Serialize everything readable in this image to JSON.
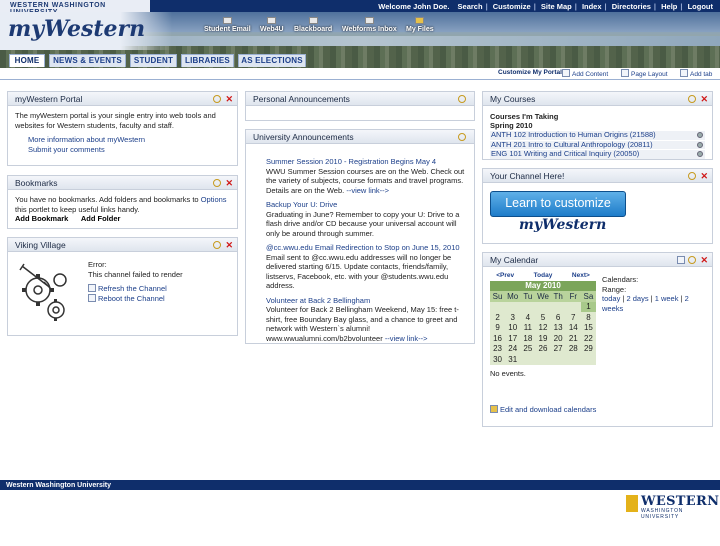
{
  "header": {
    "university": "WESTERN WASHINGTON UNIVERSITY",
    "welcome": "Welcome John Doe.",
    "links": [
      "Search",
      "Customize",
      "Site Map",
      "Index",
      "Directories",
      "Help",
      "Logout"
    ],
    "logo": "myWestern",
    "quick_links": [
      {
        "label": "Student Email",
        "icon": "email-icon"
      },
      {
        "label": "Web4U",
        "icon": "web4u-icon"
      },
      {
        "label": "Blackboard",
        "icon": "blackboard-icon"
      },
      {
        "label": "Webforms Inbox",
        "icon": "inbox-icon"
      },
      {
        "label": "My Files",
        "icon": "folder-icon"
      }
    ]
  },
  "tabs": [
    {
      "label": "HOME",
      "active": true
    },
    {
      "label": "NEWS & EVENTS",
      "active": false
    },
    {
      "label": "STUDENT",
      "active": false
    },
    {
      "label": "LIBRARIES",
      "active": false
    },
    {
      "label": "AS ELECTIONS",
      "active": false
    }
  ],
  "toolbar": {
    "customize": "Customize My Portal",
    "add_content": "Add Content",
    "page_layout": "Page Layout",
    "add_tab": "Add tab"
  },
  "portal": {
    "title": "myWestern Portal",
    "text": "The myWestern portal is your single entry into web tools and websites for Western students, faculty and staff.",
    "link1": "More information about myWestern",
    "link2": "Submit your comments"
  },
  "bookmarks": {
    "title": "Bookmarks",
    "text": "You have no bookmarks. Add folders and bookmarks to",
    "options": "Options",
    "text2": "this portlet to keep useful links handy.",
    "add_bookmark": "Add Bookmark",
    "add_folder": "Add Folder"
  },
  "viking": {
    "title": "Viking Village",
    "error": "Error:",
    "error_msg": "This channel failed to render",
    "refresh": "Refresh the Channel",
    "reboot": "Reboot the Channel"
  },
  "personal": {
    "title": "Personal Announcements"
  },
  "university": {
    "title": "University Announcements",
    "items": [
      {
        "title": "Summer Session 2010 - Registration Begins May 4",
        "body": "WWU Summer Session courses are on the Web. Check out the variety of subjects, course formats and travel programs. Details are on the Web.",
        "more": "--view link-->"
      },
      {
        "title": "Backup Your U: Drive",
        "body": "Graduating in June? Remember to copy your U: Drive to a flash drive and/or CD because your universal account will only be around through summer.",
        "more": ""
      },
      {
        "title": "@cc.wwu.edu Email Redirection to Stop on June 15, 2010",
        "body": "Email sent to @cc.wwu.edu addresses will no longer be delivered starting 6/15. Update contacts, friends/family, listservs, Facebook, etc. with your @students.wwu.edu address.",
        "more": ""
      },
      {
        "title": "Volunteer at Back 2 Bellingham",
        "body": "Volunteer for Back 2 Bellingham Weekend, May 15: free t-shirt, free Boundary Bay glass, and a chance to greet and network with Western`s alumni! www.wwualumni.com/b2bvolunteer",
        "more": "--view link-->"
      }
    ]
  },
  "courses": {
    "title": "My Courses",
    "heading1": "Courses I'm Taking",
    "heading2": "Spring 2010",
    "list": [
      "ANTH 102 Introduction to Human Origins (21588)",
      "ANTH 201 Intro to Cultural Anthropology (20811)",
      "ENG 101 Writing and Critical Inquiry (20050)"
    ]
  },
  "channel": {
    "title": "Your Channel Here!",
    "button": "Learn to customize",
    "sub": "myWestern"
  },
  "calendar": {
    "title": "My Calendar",
    "prev": "<Prev",
    "today": "Today",
    "next": "Next>",
    "month": "May 2010",
    "dow": [
      "Su",
      "Mo",
      "Tu",
      "We",
      "Th",
      "Fr",
      "Sa"
    ],
    "weeks": [
      [
        "",
        "",
        "",
        "",
        "",
        "",
        "1"
      ],
      [
        "2",
        "3",
        "4",
        "5",
        "6",
        "7",
        "8"
      ],
      [
        "9",
        "10",
        "11",
        "12",
        "13",
        "14",
        "15"
      ],
      [
        "16",
        "17",
        "18",
        "19",
        "20",
        "21",
        "22"
      ],
      [
        "23",
        "24",
        "25",
        "26",
        "27",
        "28",
        "29"
      ],
      [
        "30",
        "31",
        "",
        "",
        "",
        "",
        ""
      ]
    ],
    "calendars_label": "Calendars:",
    "range_label": "Range:",
    "range_today": "today",
    "range_2days": "2 days",
    "range_1week": "1 week",
    "range_2weeks": "2 weeks",
    "no_events": "No events.",
    "edit_link": "Edit and download calendars"
  },
  "footer": {
    "university": "Western Washington University",
    "logo_word": "WESTERN",
    "logo_sub": "WASHINGTON UNIVERSITY"
  }
}
